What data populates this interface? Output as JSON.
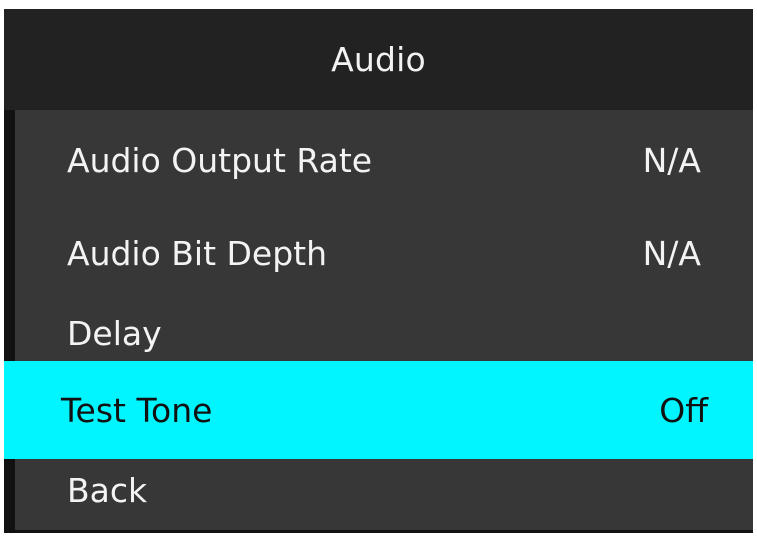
{
  "header": {
    "title": "Audio"
  },
  "menu": {
    "items": [
      {
        "label": "Audio Output Rate",
        "value": "N/A"
      },
      {
        "label": "Audio Bit Depth",
        "value": "N/A"
      },
      {
        "label": "Delay",
        "value": ""
      },
      {
        "label": "Test Tone",
        "value": "Off"
      },
      {
        "label": "Back",
        "value": ""
      }
    ],
    "selected_index": 3
  },
  "colors": {
    "background": "#373737",
    "header_background": "#222222",
    "selection": "#00f5ff",
    "text": "#f3f3f3",
    "selected_text": "#111111"
  }
}
